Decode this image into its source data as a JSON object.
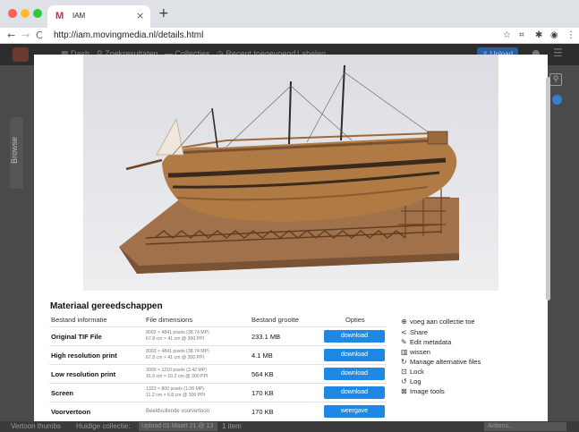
{
  "browser": {
    "tab_title": "IAM",
    "tab_logo": "M",
    "tab_close": "×",
    "new_tab": "+",
    "url": "http://iam.movingmedia.nl/details.html",
    "nav_back": "←",
    "nav_forward": "→",
    "nav_reload": "C",
    "toolbar_icons": [
      "star-icon",
      "extension-icon",
      "puzzle-icon",
      "profile-icon",
      "kebab-menu-icon"
    ]
  },
  "site_nav": {
    "items": [
      "Dash",
      "Zoekresultaten",
      "Collecties",
      "Recent toegevoegd",
      "Labelen"
    ],
    "upload_label": "Upload"
  },
  "browse_tab": "Browse",
  "modal": {
    "section_title": "Materiaal gereedschappen",
    "headers": {
      "info": "Bestand informatie",
      "dims": "File dimensions",
      "size": "Bestand grootte",
      "options": "Opties"
    },
    "rows": [
      {
        "label": "Original TIF File",
        "dims1": "8003 × 4841 pixels (38.74 MP)",
        "dims2": "67.8 cm × 41 cm @ 300 PPI",
        "size": "233.1 MB",
        "button": "download"
      },
      {
        "label": "High resolution print",
        "dims1": "8003 × 4841 pixels (38.74 MP)",
        "dims2": "67.8 cm × 41 cm @ 300 PPI",
        "size": "4.1 MB",
        "button": "download"
      },
      {
        "label": "Low resolution print",
        "dims1": "3000 × 1210 pixels (3.42 MP)",
        "dims2": "16.9 cm × 10.2 cm @ 300 PPI",
        "size": "564 KB",
        "button": "download"
      },
      {
        "label": "Screen",
        "dims1": "1323 × 800 pixels (1.06 MP)",
        "dims2": "11.2 cm × 6.8 cm @ 300 PPI",
        "size": "170 KB",
        "button": "download"
      },
      {
        "label": "Voorvertoon",
        "dims1": "Beeldvullende voorvertoon",
        "dims2": "",
        "size": "170 KB",
        "button": "weergave"
      }
    ],
    "actions": [
      {
        "icon": "plus-circle-icon",
        "glyph": "⊕",
        "label": "voeg aan collectie toe"
      },
      {
        "icon": "share-icon",
        "glyph": "<",
        "label": "Share"
      },
      {
        "icon": "pencil-icon",
        "glyph": "✎",
        "label": "Edit metadata"
      },
      {
        "icon": "trash-icon",
        "glyph": "▥",
        "label": "wissen"
      },
      {
        "icon": "sync-icon",
        "glyph": "↻",
        "label": "Manage alternative files"
      },
      {
        "icon": "lock-icon",
        "glyph": "⊡",
        "label": "Lock"
      },
      {
        "icon": "history-icon",
        "glyph": "↺",
        "label": "Log"
      },
      {
        "icon": "tools-icon",
        "glyph": "⊠",
        "label": "Image tools"
      }
    ]
  },
  "statusbar": {
    "thumbs": "Vertoon thumbs",
    "current_collection": "Huidige collectie:",
    "collection_value": "Upload 01 Maart 21 @ 13",
    "items": "1 item",
    "actions": "Actions..."
  },
  "colors": {
    "accent_blue": "#1e88e5",
    "page_bg": "#4a4a4a",
    "nav_bg": "#2d2d2d",
    "brand": "#d7263d"
  }
}
